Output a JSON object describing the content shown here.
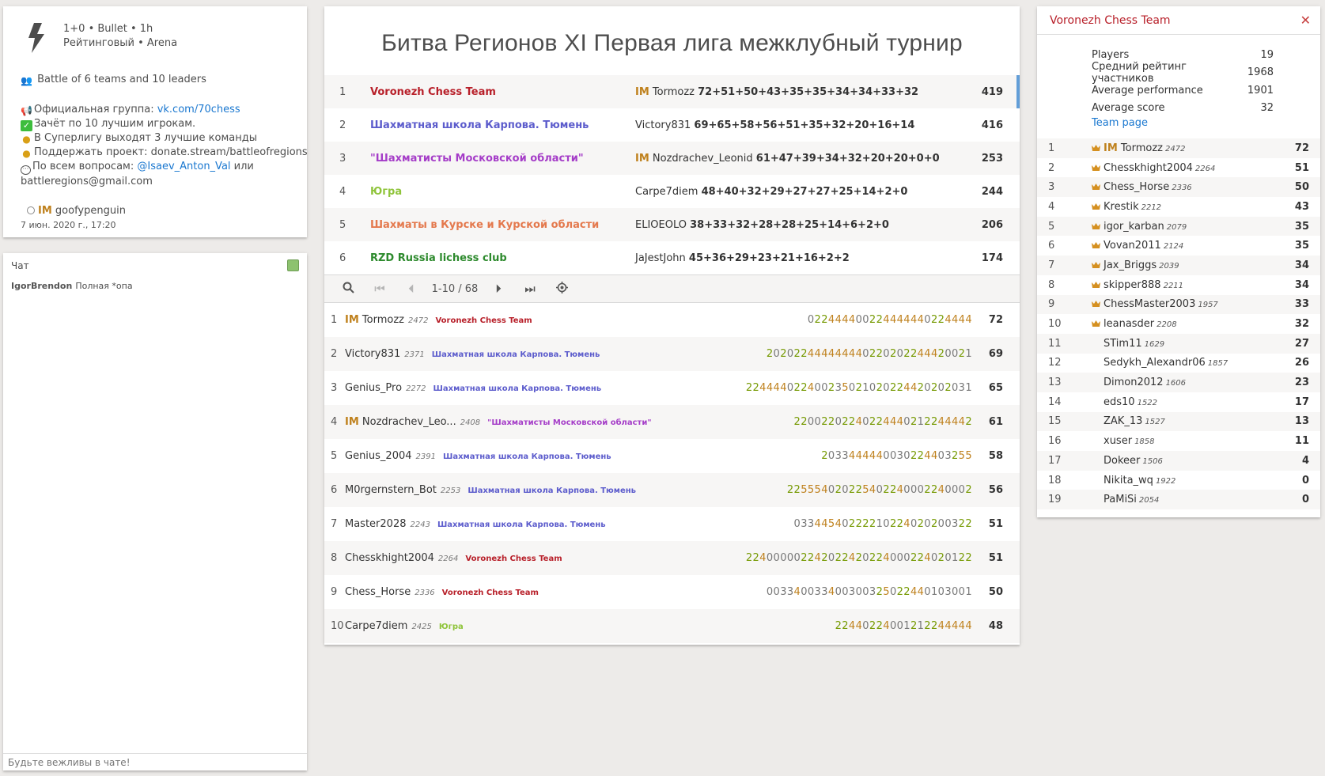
{
  "info": {
    "setup_line1": "1+0 • Bullet • 1h",
    "setup_line2": "Рейтинговый • Arena",
    "battle": "Battle of 6 teams and 10 leaders",
    "group_prefix": "Официальная группа: ",
    "group_link": "vk.com/70chess",
    "line_top10": "Зачёт по 10 лучшим игрокам.",
    "line_super": "В Суперлигу выходят 3 лучшие команды",
    "line_donate": "Поддержать проект: donate.stream/battleofregions",
    "line_contact_prefix": "По всем вопросам: ",
    "contact_link": "@Isaev_Anton_Val",
    "line_contact_suffix": " или",
    "line_email": "battleregions@gmail.com",
    "creator_title": "IM",
    "creator_name": "goofypenguin",
    "created_at": "7 июн. 2020 г., 17:20"
  },
  "chat": {
    "title": "Чат",
    "messages": [
      {
        "user": "IgorBrendon",
        "text": "Полная *опа"
      }
    ],
    "placeholder": "Будьте вежливы в чате!"
  },
  "main": {
    "title": "Битва Регионов XI Первая лига межклубный турнир",
    "teams": [
      {
        "rank": "1",
        "name": "Voronezh Chess Team",
        "color": "#b8202a",
        "title": "IM",
        "player": "Tormozz",
        "scores": "72+51+50+43+35+35+34+34+33+32",
        "total": "419"
      },
      {
        "rank": "2",
        "name": "Шахматная школа Карпова. Тюмень",
        "color": "#5c5ccc",
        "title": "",
        "player": "Victory831",
        "scores": "69+65+58+56+51+35+32+20+16+14",
        "total": "416"
      },
      {
        "rank": "3",
        "name": "\"Шахматисты Московской области\"",
        "color": "#a53dc8",
        "title": "IM",
        "player": "Nozdrachev_Leonid",
        "scores": "61+47+39+34+32+20+20+0+0",
        "total": "253"
      },
      {
        "rank": "4",
        "name": "Югра",
        "color": "#8fc43a",
        "title": "",
        "player": "Carpe7diem",
        "scores": "48+40+32+29+27+27+25+14+2+0",
        "total": "244"
      },
      {
        "rank": "5",
        "name": "Шахматы в Курске и Курской области",
        "color": "#e4794d",
        "title": "",
        "player": "ELIOEOLO",
        "scores": "38+33+32+28+28+25+14+6+2+0",
        "total": "206"
      },
      {
        "rank": "6",
        "name": "RZD Russia lichess club",
        "color": "#2d8a2d",
        "title": "",
        "player": "JaJestJohn",
        "scores": "45+36+29+23+21+16+2+2",
        "total": "174"
      }
    ],
    "pager": {
      "range": "1-10 / 68"
    },
    "players": [
      {
        "rank": "1",
        "title": "IM",
        "name": "Tormozz",
        "rating": "2472",
        "team": "Voronezh Chess Team",
        "team_color": "#b8202a",
        "sheet": "022444400224444440224444",
        "total": "72"
      },
      {
        "rank": "2",
        "title": "",
        "name": "Victory831",
        "rating": "2371",
        "team": "Шахматная школа Карпова. Тюмень",
        "team_color": "#5c5ccc",
        "sheet": "20202244444444022020224442 0021",
        "total": "69"
      },
      {
        "rank": "3",
        "title": "",
        "name": "Genius_Pro",
        "rating": "2272",
        "team": "Шахматная школа Карпова. Тюмень",
        "team_color": "#5c5ccc",
        "sheet": "224444022400235021020224420202031",
        "total": "65"
      },
      {
        "rank": "4",
        "title": "IM",
        "name": "Nozdrachev_Leo...",
        "rating": "2408",
        "team": "\"Шахматисты Московской области\"",
        "team_color": "#a53dc8",
        "sheet": "22002202240224440212244442",
        "total": "61"
      },
      {
        "rank": "5",
        "title": "",
        "name": "Genius_2004",
        "rating": "2391",
        "team": "Шахматная школа Карпова. Тюмень",
        "team_color": "#5c5ccc",
        "sheet": "2033444440030224403255",
        "total": "58"
      },
      {
        "rank": "6",
        "title": "",
        "name": "M0rgernstern_Bot",
        "rating": "2253",
        "team": "Шахматная школа Карпова. Тюмень",
        "team_color": "#5c5ccc",
        "sheet": "2255540202254022400022400 02",
        "total": "56"
      },
      {
        "rank": "7",
        "title": "",
        "name": "Master2028",
        "rating": "2243",
        "team": "Шахматная школа Карпова. Тюмень",
        "team_color": "#5c5ccc",
        "sheet": "03344540222210224020200322",
        "total": "51"
      },
      {
        "rank": "8",
        "title": "",
        "name": "Chesskhight2004",
        "rating": "2264",
        "team": "Voronezh Chess Team",
        "team_color": "#b8202a",
        "sheet": "22400000224202242022400022402 0122",
        "total": "51"
      },
      {
        "rank": "9",
        "title": "",
        "name": "Chess_Horse",
        "rating": "2336",
        "team": "Voronezh Chess Team",
        "team_color": "#b8202a",
        "sheet": "00334003340030032502244010 3001",
        "total": "50"
      },
      {
        "rank": "10",
        "title": "",
        "name": "Carpe7diem",
        "rating": "2425",
        "team": "Югра",
        "team_color": "#8fc43a",
        "sheet": "2244022400121224444 4",
        "total": "48"
      }
    ]
  },
  "team": {
    "name": "Voronezh Chess Team",
    "stats": [
      {
        "label": "Players",
        "value": "19"
      },
      {
        "label": "Средний рейтинг участников",
        "value": "1968"
      },
      {
        "label": "Average performance",
        "value": "1901"
      },
      {
        "label": "Average score",
        "value": "32"
      }
    ],
    "page_link": "Team page",
    "roster": [
      {
        "rank": "1",
        "leader": true,
        "title": "IM",
        "name": "Tormozz",
        "rating": "2472",
        "score": "72"
      },
      {
        "rank": "2",
        "leader": true,
        "title": "",
        "name": "Chesskhight2004",
        "rating": "2264",
        "score": "51"
      },
      {
        "rank": "3",
        "leader": true,
        "title": "",
        "name": "Chess_Horse",
        "rating": "2336",
        "score": "50"
      },
      {
        "rank": "4",
        "leader": true,
        "title": "",
        "name": "Krestik",
        "rating": "2212",
        "score": "43"
      },
      {
        "rank": "5",
        "leader": true,
        "title": "",
        "name": "igor_karban",
        "rating": "2079",
        "score": "35"
      },
      {
        "rank": "6",
        "leader": true,
        "title": "",
        "name": "Vovan2011",
        "rating": "2124",
        "score": "35"
      },
      {
        "rank": "7",
        "leader": true,
        "title": "",
        "name": "Jax_Briggs",
        "rating": "2039",
        "score": "34"
      },
      {
        "rank": "8",
        "leader": true,
        "title": "",
        "name": "skipper888",
        "rating": "2211",
        "score": "34"
      },
      {
        "rank": "9",
        "leader": true,
        "title": "",
        "name": "ChessMaster2003",
        "rating": "1957",
        "score": "33"
      },
      {
        "rank": "10",
        "leader": true,
        "title": "",
        "name": "leanasder",
        "rating": "2208",
        "score": "32"
      },
      {
        "rank": "11",
        "leader": false,
        "title": "",
        "name": "STim11",
        "rating": "1629",
        "score": "27"
      },
      {
        "rank": "12",
        "leader": false,
        "title": "",
        "name": "Sedykh_Alexandr06",
        "rating": "1857",
        "score": "26"
      },
      {
        "rank": "13",
        "leader": false,
        "title": "",
        "name": "Dimon2012",
        "rating": "1606",
        "score": "23"
      },
      {
        "rank": "14",
        "leader": false,
        "title": "",
        "name": "eds10",
        "rating": "1522",
        "score": "17"
      },
      {
        "rank": "15",
        "leader": false,
        "title": "",
        "name": "ZAK_13",
        "rating": "1527",
        "score": "13"
      },
      {
        "rank": "16",
        "leader": false,
        "title": "",
        "name": "xuser",
        "rating": "1858",
        "score": "11"
      },
      {
        "rank": "17",
        "leader": false,
        "title": "",
        "name": "Dokeer",
        "rating": "1506",
        "score": "4"
      },
      {
        "rank": "18",
        "leader": false,
        "title": "",
        "name": "Nikita_wq",
        "rating": "1922",
        "score": "0"
      },
      {
        "rank": "19",
        "leader": false,
        "title": "",
        "name": "PaMiSi",
        "rating": "2054",
        "score": "0"
      }
    ]
  }
}
